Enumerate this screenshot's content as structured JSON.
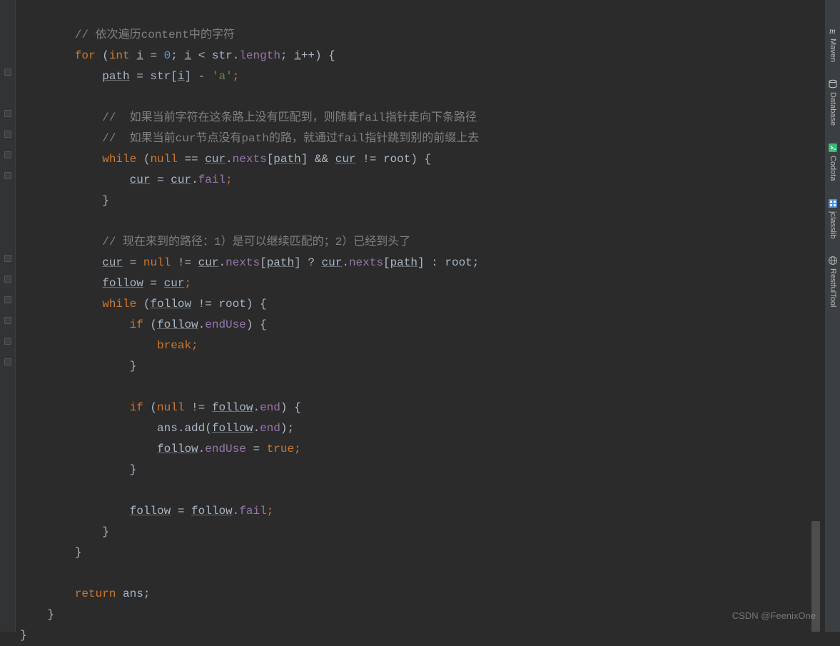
{
  "gutter": {
    "fold_positions": [
      96,
      154,
      183,
      212,
      241,
      357,
      386,
      415,
      444,
      473,
      502
    ]
  },
  "code": {
    "l1": "        // 依次遍历content中的字符",
    "l2a": "        ",
    "l2_for": "for",
    "l2_space1": " (",
    "l2_int": "int",
    "l2_space2": " ",
    "l2_i": "i",
    "l2_eq": " = ",
    "l2_zero": "0",
    "l2_semi1": "; ",
    "l2_i2": "i",
    "l2_lt": " < str.",
    "l2_len": "length",
    "l2_semi2": "; ",
    "l2_i3": "i",
    "l2_inc": "++",
    "l2_close": ") {",
    "l3a": "            ",
    "l3_path": "path",
    "l3_eq": " = str[",
    "l3_i": "i",
    "l3_bkt": "] - ",
    "l3_ch": "'a'",
    "l3_semi": ";",
    "l4": "",
    "l5": "            //  如果当前字符在这条路上没有匹配到，则随着fail指针走向下条路径",
    "l6": "            //  如果当前cur节点没有path的路，就通过fail指针跳到别的前缀上去",
    "l7a": "            ",
    "l7_while": "while",
    "l7_sp": " (",
    "l7_null": "null",
    "l7_eq": " == ",
    "l7_cur": "cur",
    "l7_dot": ".",
    "l7_nexts": "nexts",
    "l7_bkt": "[",
    "l7_path": "path",
    "l7_bkt2": "] && ",
    "l7_cur2": "cur",
    "l7_ne": " != root) {",
    "l8a": "                ",
    "l8_cur": "cur",
    "l8_eq": " = ",
    "l8_cur2": "cur",
    "l8_dot": ".",
    "l8_fail": "fail",
    "l8_semi": ";",
    "l9": "            }",
    "l10": "",
    "l11": "            // 现在来到的路径：1）是可以继续匹配的；2）已经到头了",
    "l12a": "            ",
    "l12_cur": "cur",
    "l12_eq": " = ",
    "l12_null": "null",
    "l12_ne": " != ",
    "l12_cur2": "cur",
    "l12_dot": ".",
    "l12_nexts": "nexts",
    "l12_bkt": "[",
    "l12_path": "path",
    "l12_bkt2": "] ? ",
    "l12_cur3": "cur",
    "l12_dot2": ".",
    "l12_nexts2": "nexts",
    "l12_bkt3": "[",
    "l12_path2": "path",
    "l12_bkt4": "] : root;",
    "l13a": "            ",
    "l13_follow": "follow",
    "l13_eq": " = ",
    "l13_cur": "cur",
    "l13_semi": ";",
    "l14a": "            ",
    "l14_while": "while",
    "l14_sp": " (",
    "l14_follow": "follow",
    "l14_ne": " != root) {",
    "l15a": "                ",
    "l15_if": "if",
    "l15_sp": " (",
    "l15_follow": "follow",
    "l15_dot": ".",
    "l15_endUse": "endUse",
    "l15_close": ") {",
    "l16a": "                    ",
    "l16_break": "break",
    "l16_semi": ";",
    "l17": "                }",
    "l18": "",
    "l19a": "                ",
    "l19_if": "if",
    "l19_sp": " (",
    "l19_null": "null",
    "l19_ne": " != ",
    "l19_follow": "follow",
    "l19_dot": ".",
    "l19_end": "end",
    "l19_close": ") {",
    "l20a": "                    ans.add(",
    "l20_follow": "follow",
    "l20_dot": ".",
    "l20_end": "end",
    "l20_close": ");",
    "l21a": "                    ",
    "l21_follow": "follow",
    "l21_dot": ".",
    "l21_endUse": "endUse",
    "l21_eq": " = ",
    "l21_true": "true",
    "l21_semi": ";",
    "l22": "                }",
    "l23": "",
    "l24a": "                ",
    "l24_follow": "follow",
    "l24_eq": " = ",
    "l24_follow2": "follow",
    "l24_dot": ".",
    "l24_fail": "fail",
    "l24_semi": ";",
    "l25": "            }",
    "l26": "        }",
    "l27": "",
    "l28a": "        ",
    "l28_return": "return",
    "l28_sp": " ans;",
    "l29": "    }",
    "l30": "}"
  },
  "tool_windows": [
    {
      "name": "maven",
      "label": "Maven",
      "icon": "m",
      "color": "#cccccc"
    },
    {
      "name": "database",
      "label": "Database",
      "icon": "db",
      "color": "#cccccc"
    },
    {
      "name": "codota",
      "label": "Codota",
      "icon": ">",
      "color": "#3cb878"
    },
    {
      "name": "jclasslib",
      "label": "jclasslib",
      "icon": "jc",
      "color": "#4a90d9"
    },
    {
      "name": "restfultool",
      "label": "RestfulTool",
      "icon": "globe",
      "color": "#888888"
    }
  ],
  "watermark": "CSDN @FeenixOne"
}
